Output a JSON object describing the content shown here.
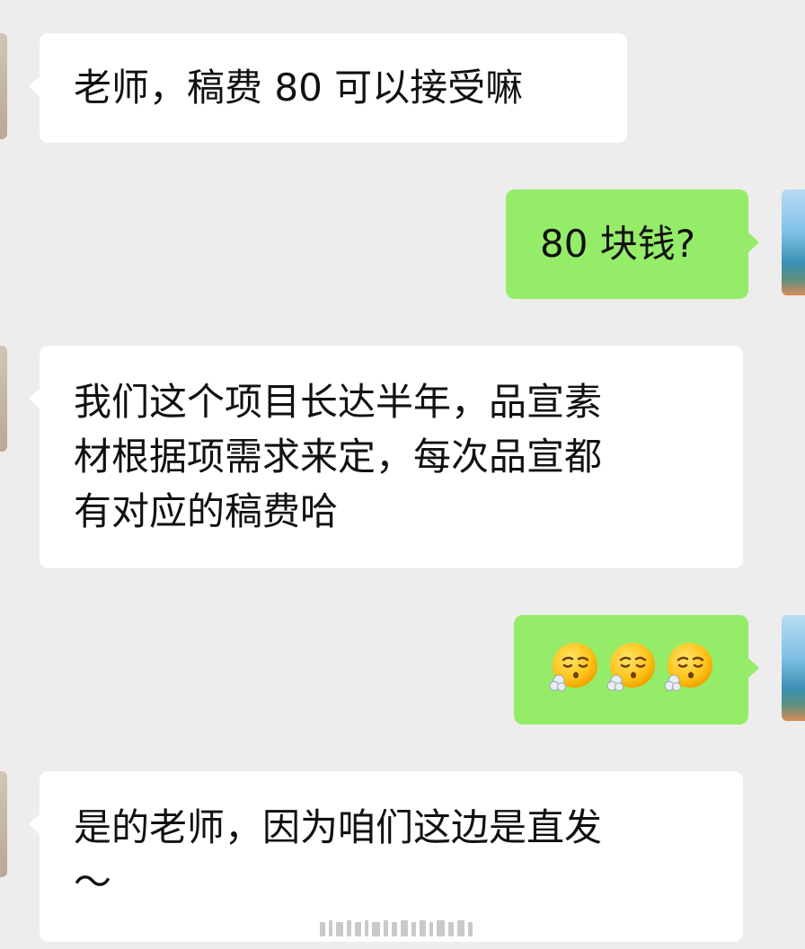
{
  "messages": [
    {
      "side": "in",
      "lines": [
        "老师，稿费 80 可以接受嘛"
      ]
    },
    {
      "side": "out",
      "lines": [
        "80 块钱?"
      ]
    },
    {
      "side": "in",
      "lines": [
        "我们这个项目长达半年，品宣素",
        "材根据项需求来定，每次品宣都",
        "有对应的稿费哈"
      ]
    },
    {
      "side": "out",
      "emoji": [
        "face-exhaling",
        "face-exhaling",
        "face-exhaling"
      ]
    },
    {
      "side": "in",
      "lines": [
        "是的老师，因为咱们这边是直发",
        "～"
      ]
    }
  ],
  "colors": {
    "background": "#ededed",
    "incoming_bubble": "#ffffff",
    "outgoing_bubble": "#95ec69",
    "text": "#111111"
  }
}
